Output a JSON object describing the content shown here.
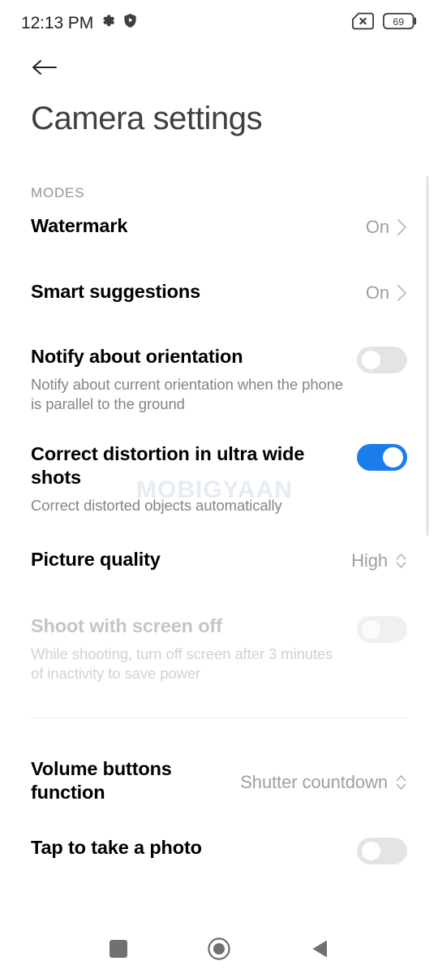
{
  "status_bar": {
    "clock": "12:13 PM",
    "left_icons": [
      "gear-icon",
      "shield-icon"
    ],
    "right_icons": [
      "no-sim-icon",
      "battery-icon"
    ],
    "battery_level": "69"
  },
  "appbar": {
    "back_icon": "arrow-left-icon"
  },
  "header": {
    "title": "Camera settings"
  },
  "watermark": {
    "text": "MOBIGYAAN"
  },
  "section": {
    "label": "MODES"
  },
  "colors": {
    "toggle_on": "#1b7ceb",
    "toggle_off_track": "#e3e4e6",
    "section_label": "#8d95a0",
    "secondary_text": "#80868b",
    "disabled_text": "#c3c6c9"
  },
  "settings": [
    {
      "id": "watermark",
      "title": "Watermark",
      "subtitle": "",
      "value": "On",
      "control": "chevron",
      "state": "enabled"
    },
    {
      "id": "smart-suggestions",
      "title": "Smart suggestions",
      "subtitle": "",
      "value": "On",
      "control": "chevron",
      "state": "enabled"
    },
    {
      "id": "notify-about-orientation",
      "title": "Notify about orientation",
      "subtitle": "Notify about current orientation when the phone is parallel to the ground",
      "value": "",
      "control": "toggle",
      "toggle": "off",
      "state": "enabled"
    },
    {
      "id": "correct-distortion",
      "title": "Correct distortion in ultra wide shots",
      "subtitle": "Correct distorted objects automatically",
      "value": "",
      "control": "toggle",
      "toggle": "on",
      "state": "enabled"
    },
    {
      "id": "picture-quality",
      "title": "Picture quality",
      "subtitle": "",
      "value": "High",
      "control": "stepper",
      "state": "enabled"
    },
    {
      "id": "shoot-with-screen-off",
      "title": "Shoot with screen off",
      "subtitle": "While shooting, turn off screen after 3 minutes of inactivity to save power",
      "value": "",
      "control": "toggle",
      "toggle": "off",
      "state": "disabled"
    },
    {
      "id": "volume-buttons-function",
      "title": "Volume buttons function",
      "subtitle": "",
      "value": "Shutter countdown",
      "control": "stepper",
      "state": "enabled"
    },
    {
      "id": "tap-to-take-a-photo",
      "title": "Tap to take a photo",
      "subtitle": "",
      "value": "",
      "control": "toggle",
      "toggle": "off",
      "state": "enabled"
    }
  ],
  "navbar": {
    "items": [
      {
        "id": "recents",
        "icon": "square-icon"
      },
      {
        "id": "home",
        "icon": "circle-icon"
      },
      {
        "id": "back",
        "icon": "triangle-left-icon"
      }
    ]
  }
}
